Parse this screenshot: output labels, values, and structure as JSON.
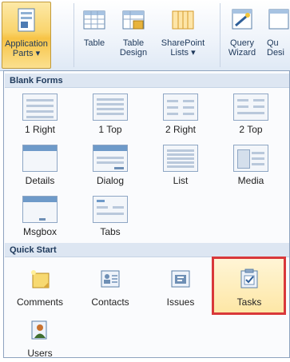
{
  "ribbon": {
    "buttons": [
      {
        "label": "Application\nParts ▾",
        "icon": "application-parts-icon"
      },
      {
        "label": "Table",
        "icon": "table-icon"
      },
      {
        "label": "Table\nDesign",
        "icon": "table-design-icon"
      },
      {
        "label": "SharePoint\nLists ▾",
        "icon": "sharepoint-lists-icon"
      },
      {
        "label": "Query\nWizard",
        "icon": "query-wizard-icon"
      },
      {
        "label": "Qu\nDesi",
        "icon": "query-design-icon"
      }
    ]
  },
  "menu": {
    "blank_forms_header": "Blank Forms",
    "blank_forms": [
      {
        "label": "1 Right"
      },
      {
        "label": "1 Top"
      },
      {
        "label": "2 Right"
      },
      {
        "label": "2 Top"
      },
      {
        "label": "Details"
      },
      {
        "label": "Dialog"
      },
      {
        "label": "List"
      },
      {
        "label": "Media"
      },
      {
        "label": "Msgbox"
      },
      {
        "label": "Tabs"
      }
    ],
    "quick_start_header": "Quick Start",
    "quick_start": [
      {
        "label": "Comments",
        "icon": "comments-icon"
      },
      {
        "label": "Contacts",
        "icon": "contacts-icon"
      },
      {
        "label": "Issues",
        "icon": "issues-icon"
      },
      {
        "label": "Tasks",
        "icon": "tasks-icon"
      },
      {
        "label": "Users",
        "icon": "users-icon"
      }
    ],
    "selected": "Tasks",
    "highlight_color": "#d9383a"
  }
}
